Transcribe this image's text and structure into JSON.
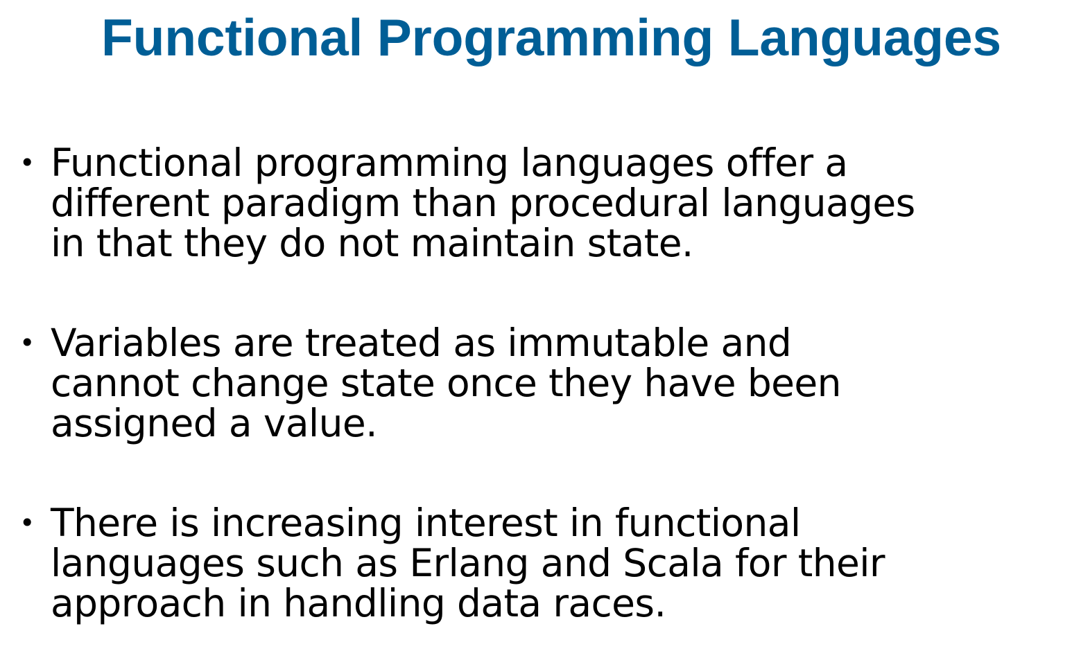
{
  "slide": {
    "title": "Functional Programming Languages",
    "bullet_glyph": "•",
    "bullets": [
      {
        "text": "Functional programming languages offer a\ndifferent paradigm than procedural languages\nin that they do not maintain state."
      },
      {
        "text": "Variables are treated as immutable and\ncannot change state once they have been\nassigned a value."
      },
      {
        "text": "There is increasing interest in functional\nlanguages such as Erlang and Scala for their\napproach in handling data races."
      }
    ]
  },
  "colors": {
    "title": "#005e96",
    "body_text": "#000000",
    "background": "#ffffff"
  }
}
